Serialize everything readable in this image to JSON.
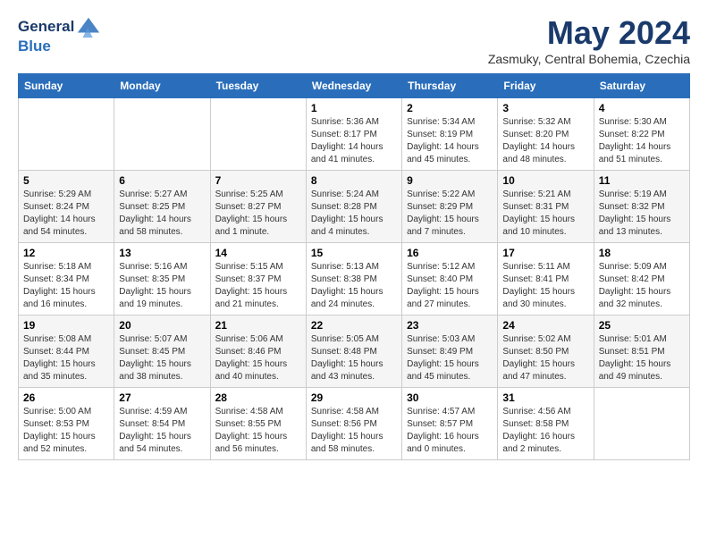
{
  "header": {
    "logo_line1": "General",
    "logo_line2": "Blue",
    "month_title": "May 2024",
    "subtitle": "Zasmuky, Central Bohemia, Czechia"
  },
  "days_of_week": [
    "Sunday",
    "Monday",
    "Tuesday",
    "Wednesday",
    "Thursday",
    "Friday",
    "Saturday"
  ],
  "weeks": [
    [
      {
        "day": "",
        "info": ""
      },
      {
        "day": "",
        "info": ""
      },
      {
        "day": "",
        "info": ""
      },
      {
        "day": "1",
        "info": "Sunrise: 5:36 AM\nSunset: 8:17 PM\nDaylight: 14 hours\nand 41 minutes."
      },
      {
        "day": "2",
        "info": "Sunrise: 5:34 AM\nSunset: 8:19 PM\nDaylight: 14 hours\nand 45 minutes."
      },
      {
        "day": "3",
        "info": "Sunrise: 5:32 AM\nSunset: 8:20 PM\nDaylight: 14 hours\nand 48 minutes."
      },
      {
        "day": "4",
        "info": "Sunrise: 5:30 AM\nSunset: 8:22 PM\nDaylight: 14 hours\nand 51 minutes."
      }
    ],
    [
      {
        "day": "5",
        "info": "Sunrise: 5:29 AM\nSunset: 8:24 PM\nDaylight: 14 hours\nand 54 minutes."
      },
      {
        "day": "6",
        "info": "Sunrise: 5:27 AM\nSunset: 8:25 PM\nDaylight: 14 hours\nand 58 minutes."
      },
      {
        "day": "7",
        "info": "Sunrise: 5:25 AM\nSunset: 8:27 PM\nDaylight: 15 hours\nand 1 minute."
      },
      {
        "day": "8",
        "info": "Sunrise: 5:24 AM\nSunset: 8:28 PM\nDaylight: 15 hours\nand 4 minutes."
      },
      {
        "day": "9",
        "info": "Sunrise: 5:22 AM\nSunset: 8:29 PM\nDaylight: 15 hours\nand 7 minutes."
      },
      {
        "day": "10",
        "info": "Sunrise: 5:21 AM\nSunset: 8:31 PM\nDaylight: 15 hours\nand 10 minutes."
      },
      {
        "day": "11",
        "info": "Sunrise: 5:19 AM\nSunset: 8:32 PM\nDaylight: 15 hours\nand 13 minutes."
      }
    ],
    [
      {
        "day": "12",
        "info": "Sunrise: 5:18 AM\nSunset: 8:34 PM\nDaylight: 15 hours\nand 16 minutes."
      },
      {
        "day": "13",
        "info": "Sunrise: 5:16 AM\nSunset: 8:35 PM\nDaylight: 15 hours\nand 19 minutes."
      },
      {
        "day": "14",
        "info": "Sunrise: 5:15 AM\nSunset: 8:37 PM\nDaylight: 15 hours\nand 21 minutes."
      },
      {
        "day": "15",
        "info": "Sunrise: 5:13 AM\nSunset: 8:38 PM\nDaylight: 15 hours\nand 24 minutes."
      },
      {
        "day": "16",
        "info": "Sunrise: 5:12 AM\nSunset: 8:40 PM\nDaylight: 15 hours\nand 27 minutes."
      },
      {
        "day": "17",
        "info": "Sunrise: 5:11 AM\nSunset: 8:41 PM\nDaylight: 15 hours\nand 30 minutes."
      },
      {
        "day": "18",
        "info": "Sunrise: 5:09 AM\nSunset: 8:42 PM\nDaylight: 15 hours\nand 32 minutes."
      }
    ],
    [
      {
        "day": "19",
        "info": "Sunrise: 5:08 AM\nSunset: 8:44 PM\nDaylight: 15 hours\nand 35 minutes."
      },
      {
        "day": "20",
        "info": "Sunrise: 5:07 AM\nSunset: 8:45 PM\nDaylight: 15 hours\nand 38 minutes."
      },
      {
        "day": "21",
        "info": "Sunrise: 5:06 AM\nSunset: 8:46 PM\nDaylight: 15 hours\nand 40 minutes."
      },
      {
        "day": "22",
        "info": "Sunrise: 5:05 AM\nSunset: 8:48 PM\nDaylight: 15 hours\nand 43 minutes."
      },
      {
        "day": "23",
        "info": "Sunrise: 5:03 AM\nSunset: 8:49 PM\nDaylight: 15 hours\nand 45 minutes."
      },
      {
        "day": "24",
        "info": "Sunrise: 5:02 AM\nSunset: 8:50 PM\nDaylight: 15 hours\nand 47 minutes."
      },
      {
        "day": "25",
        "info": "Sunrise: 5:01 AM\nSunset: 8:51 PM\nDaylight: 15 hours\nand 49 minutes."
      }
    ],
    [
      {
        "day": "26",
        "info": "Sunrise: 5:00 AM\nSunset: 8:53 PM\nDaylight: 15 hours\nand 52 minutes."
      },
      {
        "day": "27",
        "info": "Sunrise: 4:59 AM\nSunset: 8:54 PM\nDaylight: 15 hours\nand 54 minutes."
      },
      {
        "day": "28",
        "info": "Sunrise: 4:58 AM\nSunset: 8:55 PM\nDaylight: 15 hours\nand 56 minutes."
      },
      {
        "day": "29",
        "info": "Sunrise: 4:58 AM\nSunset: 8:56 PM\nDaylight: 15 hours\nand 58 minutes."
      },
      {
        "day": "30",
        "info": "Sunrise: 4:57 AM\nSunset: 8:57 PM\nDaylight: 16 hours\nand 0 minutes."
      },
      {
        "day": "31",
        "info": "Sunrise: 4:56 AM\nSunset: 8:58 PM\nDaylight: 16 hours\nand 2 minutes."
      },
      {
        "day": "",
        "info": ""
      }
    ]
  ]
}
